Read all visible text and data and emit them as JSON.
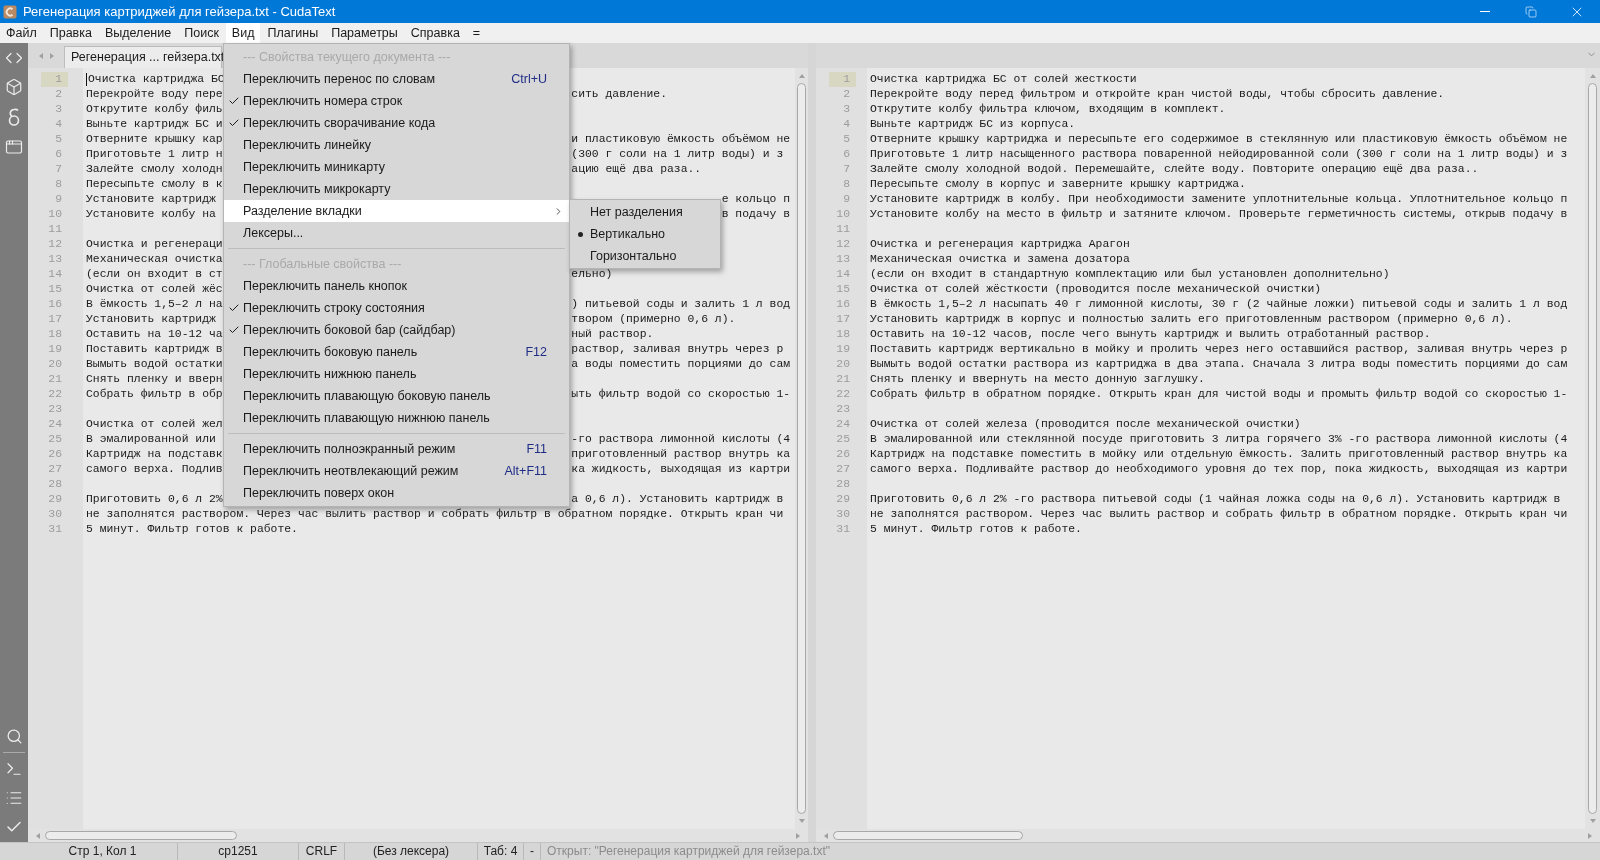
{
  "window": {
    "title": "Регенерация картриджей для гейзера.txt - CudaText"
  },
  "menu_bar": [
    {
      "label": "Файл",
      "selected": false
    },
    {
      "label": "Правка",
      "selected": false
    },
    {
      "label": "Выделение",
      "selected": false
    },
    {
      "label": "Поиск",
      "selected": false
    },
    {
      "label": "Вид",
      "selected": true
    },
    {
      "label": "Плагины",
      "selected": false
    },
    {
      "label": "Параметры",
      "selected": false
    },
    {
      "label": "Справка",
      "selected": false
    },
    {
      "label": "=",
      "selected": false
    }
  ],
  "view_menu": {
    "items": [
      {
        "kind": "header",
        "label": "--- Свойства текущего документа ---"
      },
      {
        "kind": "item",
        "label": "Переключить перенос по словам",
        "shortcut": "Ctrl+U",
        "checked": false,
        "selected": false
      },
      {
        "kind": "item",
        "label": "Переключить номера строк",
        "checked": true,
        "selected": false
      },
      {
        "kind": "item",
        "label": "Переключить сворачивание кода",
        "checked": true,
        "selected": false
      },
      {
        "kind": "item",
        "label": "Переключить линейку",
        "checked": false,
        "selected": false
      },
      {
        "kind": "item",
        "label": "Переключить миникарту",
        "checked": false,
        "selected": false
      },
      {
        "kind": "item",
        "label": "Переключить микрокарту",
        "checked": false,
        "selected": false
      },
      {
        "kind": "submenu",
        "label": "Разделение вкладки",
        "checked": false,
        "selected": true
      },
      {
        "kind": "item",
        "label": "Лексеры...",
        "checked": false,
        "selected": false
      },
      {
        "kind": "separator"
      },
      {
        "kind": "header",
        "label": "--- Глобальные свойства ---"
      },
      {
        "kind": "item",
        "label": "Переключить панель кнопок",
        "checked": false,
        "selected": false
      },
      {
        "kind": "item",
        "label": "Переключить строку состояния",
        "checked": true,
        "selected": false
      },
      {
        "kind": "item",
        "label": "Переключить боковой бар (сайдбар)",
        "checked": true,
        "selected": false
      },
      {
        "kind": "item",
        "label": "Переключить боковую панель",
        "shortcut": "F12",
        "checked": false,
        "selected": false
      },
      {
        "kind": "item",
        "label": "Переключить нижнюю панель",
        "checked": false,
        "selected": false
      },
      {
        "kind": "item",
        "label": "Переключить плавающую боковую панель",
        "checked": false,
        "selected": false
      },
      {
        "kind": "item",
        "label": "Переключить плавающую нижнюю панель",
        "checked": false,
        "selected": false
      },
      {
        "kind": "separator"
      },
      {
        "kind": "item",
        "label": "Переключить полноэкранный режим",
        "shortcut": "F11",
        "checked": false,
        "selected": false
      },
      {
        "kind": "item",
        "label": "Переключить неотвлекающий режим",
        "shortcut": "Alt+F11",
        "checked": false,
        "selected": false
      },
      {
        "kind": "item",
        "label": "Переключить поверх окон",
        "checked": false,
        "selected": false
      }
    ]
  },
  "split_submenu": {
    "items": [
      {
        "label": "Нет разделения",
        "selected": false
      },
      {
        "label": "Вертикально",
        "selected": true
      },
      {
        "label": "Горизонтально",
        "selected": false
      }
    ]
  },
  "left_pane": {
    "tab": {
      "label": "Регенерация ... гейзера.txt"
    },
    "focused": true,
    "lines": [
      {
        "number": "1",
        "current": true,
        "kind": "split",
        "start": "Очистка картриджа БС"
      },
      {
        "number": "2",
        "current": false,
        "kind": "split",
        "start": "Перекройте воду пере",
        "end": "сить давление."
      },
      {
        "number": "3",
        "current": false,
        "kind": "split",
        "start": "Открутите колбу филь"
      },
      {
        "number": "4",
        "current": false,
        "kind": "split",
        "start": "Выньте картридж БС и"
      },
      {
        "number": "5",
        "current": false,
        "kind": "split",
        "start": "Отверните крышку кар",
        "end": "и пластиковую ёмкость объёмом не"
      },
      {
        "number": "6",
        "current": false,
        "kind": "split",
        "start": "Приготовьте 1 литр н",
        "end": "(300 г соли на 1 литр воды) и з"
      },
      {
        "number": "7",
        "current": false,
        "kind": "split",
        "start": "Залейте смолу холодн",
        "end": "ацию ещё два раза.."
      },
      {
        "number": "8",
        "current": false,
        "kind": "split",
        "start": "Пересыпьте смолу в к"
      },
      {
        "number": "9",
        "current": false,
        "kind": "tail",
        "start": "Установите картридж",
        "end": "е кольцо п"
      },
      {
        "number": "10",
        "current": false,
        "kind": "tail",
        "start": "Установите колбу на",
        "end": "в подачу в"
      },
      {
        "number": "11",
        "current": false,
        "kind": "blank"
      },
      {
        "number": "12",
        "current": false,
        "kind": "split",
        "start": "Очистка и регенераци"
      },
      {
        "number": "13",
        "current": false,
        "kind": "split",
        "start": "Механическая очистка"
      },
      {
        "number": "14",
        "current": false,
        "kind": "split",
        "start": "(если он входит в ст",
        "end": "ельно)"
      },
      {
        "number": "15",
        "current": false,
        "kind": "split",
        "start": "Очистка от солей жёс"
      },
      {
        "number": "16",
        "current": false,
        "kind": "split",
        "start": "В ёмкость 1,5–2 л на",
        "end": ") питьевой соды и залить 1 л вод"
      },
      {
        "number": "17",
        "current": false,
        "kind": "split",
        "start": "Установить картридж",
        "end": "твором (примерно 0,6 л)."
      },
      {
        "number": "18",
        "current": false,
        "kind": "split",
        "start": "Оставить на 10-12 ча",
        "end": "ный раствор."
      },
      {
        "number": "19",
        "current": false,
        "kind": "split",
        "start": "Поставить картридж в",
        "end": "раствор, заливая внутрь через р"
      },
      {
        "number": "20",
        "current": false,
        "kind": "split",
        "start": "Вымыть водой остатки",
        "end": "а воды поместить порциями до сам"
      },
      {
        "number": "21",
        "current": false,
        "kind": "split",
        "start": "Снять пленку и вверн"
      },
      {
        "number": "22",
        "current": false,
        "kind": "split",
        "start": "Собрать фильтр в обр",
        "end": "ыть фильтр водой со скоростью 1-"
      },
      {
        "number": "23",
        "current": false,
        "kind": "blank"
      },
      {
        "number": "24",
        "current": false,
        "kind": "split",
        "start": "Очистка от солей жел"
      },
      {
        "number": "25",
        "current": false,
        "kind": "split",
        "start": "В эмалированной или",
        "end": "-го раствора лимонной кислоты (4"
      },
      {
        "number": "26",
        "current": false,
        "kind": "split",
        "start": "Картридж на подставк",
        "end": "приготовленный раствор внутрь ка"
      },
      {
        "number": "27",
        "current": false,
        "kind": "split",
        "start": "самого верха. Подлив",
        "end": "ка жидкость, выходящая из картри"
      },
      {
        "number": "28",
        "current": false,
        "kind": "blank"
      },
      {
        "number": "29",
        "current": false,
        "kind": "split",
        "start": "Приготовить 0,6 л 2%",
        "end": "а 0,6 л). Установить картридж в"
      },
      {
        "number": "30",
        "current": false,
        "kind": "full",
        "start": "не заполнятся раствором. Через час вылить раствор и собрать фильтр в обратном порядке. Открыть кран чи"
      },
      {
        "number": "31",
        "current": false,
        "kind": "full",
        "start": "5 минут. Фильтр готов к работе."
      }
    ]
  },
  "right_pane": {
    "lines": [
      {
        "number": "1",
        "current": true,
        "kind": "full",
        "start": "Очистка картриджа БС от солей жесткости"
      },
      {
        "number": "2",
        "current": false,
        "kind": "full",
        "start": "Перекройте воду перед фильтром и откройте кран чистой воды, чтобы сбросить давление."
      },
      {
        "number": "3",
        "current": false,
        "kind": "full",
        "start": "Открутите колбу фильтра ключом, входящим в комплект."
      },
      {
        "number": "4",
        "current": false,
        "kind": "full",
        "start": "Выньте картридж БС из корпуса."
      },
      {
        "number": "5",
        "current": false,
        "kind": "full",
        "start": "Отверните крышку картриджа и пересыпьте его содержимое в стеклянную или пластиковую ёмкость объёмом не"
      },
      {
        "number": "6",
        "current": false,
        "kind": "full",
        "start": "Приготовьте 1 литр насыщенного раствора поваренной нейодированной соли (300 г соли на 1 литр воды) и з"
      },
      {
        "number": "7",
        "current": false,
        "kind": "full",
        "start": "Залейте смолу холодной водой. Перемешайте, слейте воду. Повторите операцию ещё два раза.."
      },
      {
        "number": "8",
        "current": false,
        "kind": "full",
        "start": "Пересыпьте смолу в корпус и заверните крышку картриджа."
      },
      {
        "number": "9",
        "current": false,
        "kind": "full",
        "start": "Установите картридж в колбу. При необходимости замените уплотнительные кольца. Уплотнительное кольцо п"
      },
      {
        "number": "10",
        "current": false,
        "kind": "full",
        "start": "Установите колбу на место в фильтр и затяните ключом. Проверьте герметичность системы, открыв подачу в"
      },
      {
        "number": "11",
        "current": false,
        "kind": "blank"
      },
      {
        "number": "12",
        "current": false,
        "kind": "full",
        "start": "Очистка и регенерация картриджа Арагон"
      },
      {
        "number": "13",
        "current": false,
        "kind": "full",
        "start": "Механическая очистка и замена дозатора"
      },
      {
        "number": "14",
        "current": false,
        "kind": "full",
        "start": "(если он входит в стандартную комплектацию или был установлен дополнительно)"
      },
      {
        "number": "15",
        "current": false,
        "kind": "full",
        "start": "Очистка от солей жёсткости (проводится после механической очистки)"
      },
      {
        "number": "16",
        "current": false,
        "kind": "full",
        "start": "В ёмкость 1,5–2 л насыпать 40 г лимонной кислоты, 30 г (2 чайные ложки) питьевой соды и залить 1 л вод"
      },
      {
        "number": "17",
        "current": false,
        "kind": "full",
        "start": "Установить картридж в корпус и полностью залить его приготовленным раствором (примерно 0,6 л)."
      },
      {
        "number": "18",
        "current": false,
        "kind": "full",
        "start": "Оставить на 10-12 часов, после чего вынуть картридж и вылить отработанный раствор."
      },
      {
        "number": "19",
        "current": false,
        "kind": "full",
        "start": "Поставить картридж вертикально в мойку и пролить через него оставшийся раствор, заливая внутрь через р"
      },
      {
        "number": "20",
        "current": false,
        "kind": "full",
        "start": "Вымыть водой остатки раствора из картриджа в два этапа. Сначала 3 литра воды поместить порциями до сам"
      },
      {
        "number": "21",
        "current": false,
        "kind": "full",
        "start": "Снять пленку и ввернуть на место донную заглушку."
      },
      {
        "number": "22",
        "current": false,
        "kind": "full",
        "start": "Собрать фильтр в обратном порядке. Открыть кран для чистой воды и промыть фильтр водой со скоростью 1-"
      },
      {
        "number": "23",
        "current": false,
        "kind": "blank"
      },
      {
        "number": "24",
        "current": false,
        "kind": "full",
        "start": "Очистка от солей железа (проводится после механической очистки)"
      },
      {
        "number": "25",
        "current": false,
        "kind": "full",
        "start": "В эмалированной или стеклянной посуде приготовить 3 литра горячего 3% -го раствора лимонной кислоты (4"
      },
      {
        "number": "26",
        "current": false,
        "kind": "full",
        "start": "Картридж на подставке поместить в мойку или отдельную ёмкость. Залить приготовленный раствор внутрь ка"
      },
      {
        "number": "27",
        "current": false,
        "kind": "full",
        "start": "самого верха. Подливайте раствор до необходимого уровня до тех пор, пока жидкость, выходящая из картри"
      },
      {
        "number": "28",
        "current": false,
        "kind": "blank"
      },
      {
        "number": "29",
        "current": false,
        "kind": "full",
        "start": "Приготовить 0,6 л 2% -го раствора питьевой соды (1 чайная ложка соды на 0,6 л). Установить картридж в"
      },
      {
        "number": "30",
        "current": false,
        "kind": "full",
        "start": "не заполнятся раствором. Через час вылить раствор и собрать фильтр в обратном порядке. Открыть кран чи"
      },
      {
        "number": "31",
        "current": false,
        "kind": "full",
        "start": "5 минут. Фильтр готов к работе."
      }
    ]
  },
  "status_bar": [
    {
      "kind": "field",
      "text": "Стр 1, Кол 1"
    },
    {
      "kind": "field",
      "text": "cp1251"
    },
    {
      "kind": "field",
      "text": "CRLF"
    },
    {
      "kind": "field",
      "text": "(Без лексера)"
    },
    {
      "kind": "field",
      "text": "Таб: 4"
    },
    {
      "kind": "field",
      "text": "-"
    },
    {
      "kind": "message",
      "text": "Открыт: \"Регенерация картриджей для гейзера.txt\""
    }
  ]
}
